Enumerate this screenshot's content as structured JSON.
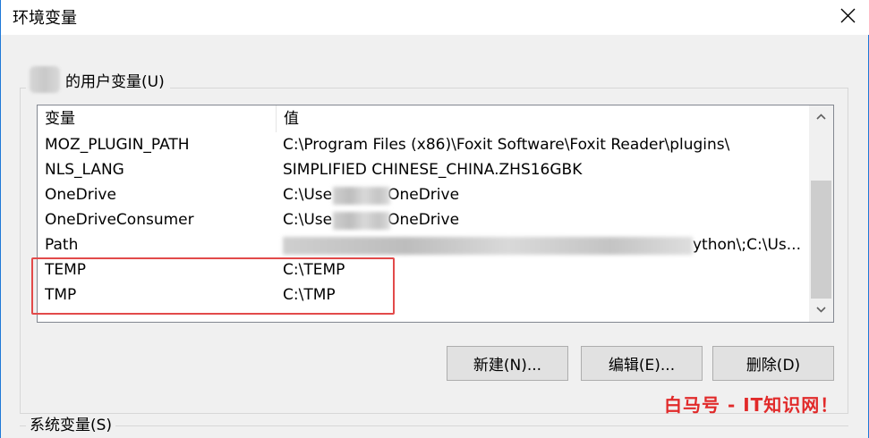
{
  "window": {
    "title": "环境变量"
  },
  "user_vars": {
    "label": "的用户变量(U)",
    "columns": {
      "variable": "变量",
      "value": "值"
    },
    "rows": [
      {
        "name": "MOZ_PLUGIN_PATH",
        "value": "C:\\Program Files (x86)\\Foxit Software\\Foxit Reader\\plugins\\"
      },
      {
        "name": "NLS_LANG",
        "value": "SIMPLIFIED CHINESE_CHINA.ZHS16GBK"
      },
      {
        "name": "OneDrive",
        "value_prefix": "C:\\Use",
        "value_suffix": "OneDrive"
      },
      {
        "name": "OneDriveConsumer",
        "value_prefix": "C:\\Use",
        "value_suffix": "OneDrive"
      },
      {
        "name": "Path",
        "value_suffix": "ython\\;C:\\Us..."
      },
      {
        "name": "TEMP",
        "value": "C:\\TEMP"
      },
      {
        "name": "TMP",
        "value": "C:\\TMP"
      }
    ]
  },
  "buttons": {
    "new": "新建(N)...",
    "edit": "编辑(E)...",
    "delete": "删除(D)"
  },
  "system_vars": {
    "label": "系统变量(S)"
  },
  "watermark": "白马号 - IT知识网！",
  "colors": {
    "highlight_border": "#e24a4a",
    "watermark": "#e12a2a",
    "window_border": "#1e78d7"
  },
  "icons": {
    "close": "close-icon",
    "scroll_up": "chevron-up-icon",
    "scroll_down": "chevron-down-icon"
  }
}
